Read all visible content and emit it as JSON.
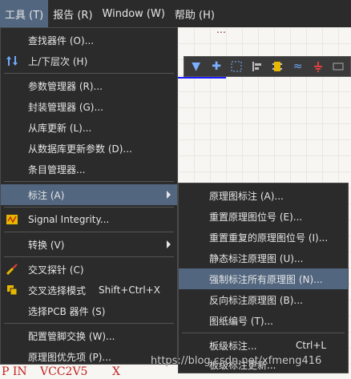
{
  "menubar": {
    "items": [
      {
        "label": "工具 (T)"
      },
      {
        "label": "报告 (R)"
      },
      {
        "label": "Window (W)"
      },
      {
        "label": "帮助 (H)"
      }
    ]
  },
  "tools_menu": {
    "items": [
      {
        "label": "查找器件 (O)..."
      },
      {
        "label": "上/下层次 (H)"
      },
      {
        "label": "参数管理器 (R)..."
      },
      {
        "label": "封装管理器 (G)..."
      },
      {
        "label": "从库更新 (L)..."
      },
      {
        "label": "从数据库更新参数 (D)..."
      },
      {
        "label": "条目管理器..."
      },
      {
        "label": "标注 (A)"
      },
      {
        "label": "Signal Integrity..."
      },
      {
        "label": "转换 (V)"
      },
      {
        "label": "交叉探针 (C)"
      },
      {
        "label": "交叉选择模式",
        "shortcut": "Shift+Ctrl+X"
      },
      {
        "label": "选择PCB 器件 (S)"
      },
      {
        "label": "配置管脚交换 (W)..."
      },
      {
        "label": "原理图优先项 (P)..."
      }
    ]
  },
  "annotate_submenu": {
    "items": [
      {
        "label": "原理图标注 (A)..."
      },
      {
        "label": "重置原理图位号 (E)..."
      },
      {
        "label": "重置重复的原理图位号 (I)..."
      },
      {
        "label": "静态标注原理图 (U)..."
      },
      {
        "label": "强制标注所有原理图 (N)..."
      },
      {
        "label": "反向标注原理图 (B)..."
      },
      {
        "label": "图纸编号 (T)..."
      },
      {
        "label": "板级标注...",
        "shortcut": "Ctrl+L"
      },
      {
        "label": "板级标注更新..."
      }
    ]
  },
  "watermark": "https://blog.csdn.net/xfmeng416",
  "canvas": {
    "bottom_left": "P IN",
    "bottom_mid": "VCC2V5",
    "bottom_x": "X"
  },
  "colors": {
    "menu_bg": "#2b2b2b",
    "highlight": "#52667f"
  }
}
